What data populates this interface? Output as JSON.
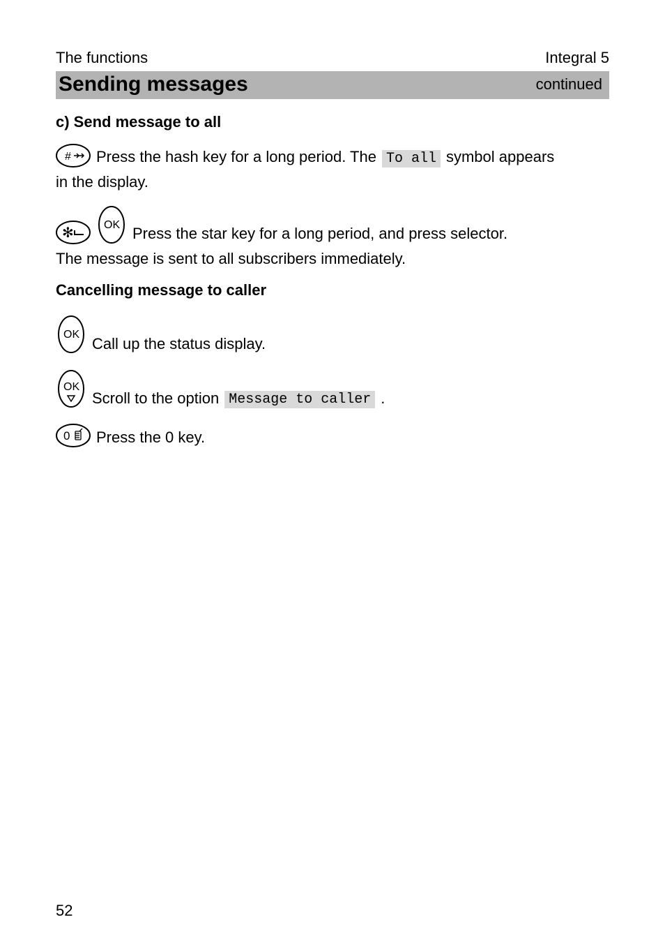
{
  "header": {
    "left": "The functions",
    "right": "Integral 5"
  },
  "titleBar": {
    "title": "Sending messages",
    "continued": "continued"
  },
  "sectionC": {
    "heading": "c) Send message to all",
    "hashLine_before": " Press the hash key for a long period. The ",
    "toAll": "To all",
    "hashLine_after_1": " symbol appears",
    "hashLine_wrap": "in the display.",
    "starLine": " Press the star key for a long period, and press selector.",
    "starLine2": "The message is sent to all subscribers immediately."
  },
  "cancel": {
    "heading": "Cancelling message to caller",
    "line1": " Call up the status display.",
    "line2_before": " Scroll to the option ",
    "msgToCaller": "Message to caller",
    "line2_after": " .",
    "line3": " Press the 0 key."
  },
  "pageNumber": "52"
}
